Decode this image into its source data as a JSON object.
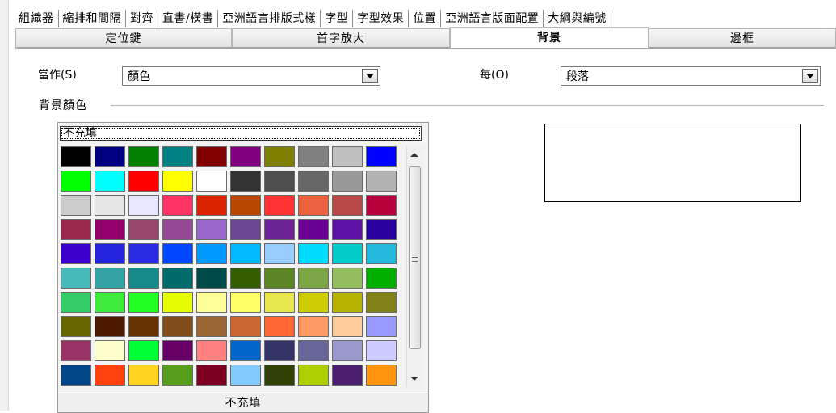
{
  "tabs_row1": [
    "組織器",
    "縮排和間隔",
    "對齊",
    "直書/橫書",
    "亞洲語言排版式樣",
    "字型",
    "字型效果",
    "位置",
    "亞洲語言版面配置",
    "大綱與編號"
  ],
  "tabs_row2": [
    {
      "label": "定位鍵",
      "active": false
    },
    {
      "label": "首字放大",
      "active": false
    },
    {
      "label": "背景",
      "active": true
    },
    {
      "label": "邊框",
      "active": false
    }
  ],
  "as_field": {
    "label": "當作(S)",
    "value": "顏色"
  },
  "for_field": {
    "label": "每(O)",
    "value": "段落"
  },
  "group_title": "背景顏色",
  "no_fill_top": "不充填",
  "no_fill_bottom": "不充填",
  "palette": [
    [
      "#000000",
      "#000080",
      "#008000",
      "#008080",
      "#800000",
      "#800080",
      "#808000",
      "#808080",
      "#c0c0c0",
      "#0000ff"
    ],
    [
      "#00ff00",
      "#00ffff",
      "#ff0000",
      "#ffff00",
      "#ffffff",
      "#333333",
      "#4d4d4d",
      "#666666",
      "#999999",
      "#b3b3b3"
    ],
    [
      "#cccccc",
      "#e6e6e6",
      "#e6e6ff",
      "#ff3366",
      "#dc2300",
      "#b84700",
      "#ff3333",
      "#eb613d",
      "#b84747",
      "#b8003d"
    ],
    [
      "#99284c",
      "#94006b",
      "#94476b",
      "#944794",
      "#9966cc",
      "#6b4794",
      "#6b2394",
      "#6b0094",
      "#5e11a6",
      "#28009e"
    ],
    [
      "#3d00cc",
      "#2323dc",
      "#2a2ae0",
      "#0047ff",
      "#0099ff",
      "#00b8ff",
      "#99ccff",
      "#00dcff",
      "#00cccc",
      "#23b8dc"
    ],
    [
      "#47b8b8",
      "#33a3a3",
      "#198a8a",
      "#006b6b",
      "#004a4a",
      "#355e00",
      "#5c8526",
      "#7da647",
      "#94bd5e",
      "#00ae00"
    ],
    [
      "#33cc66",
      "#3deb3d",
      "#23ff23",
      "#e6ff00",
      "#ffff99",
      "#ffff66",
      "#e6e64c",
      "#cccc00",
      "#b3b300",
      "#808019"
    ],
    [
      "#666600",
      "#4c1900",
      "#663300",
      "#804c19",
      "#996633",
      "#cc6633",
      "#ff6633",
      "#ff9966",
      "#ffcc99",
      "#9999ff"
    ],
    [
      "#993366",
      "#ffffcc",
      "#00ff33",
      "#660066",
      "#ff8080",
      "#0066cc",
      "#333366",
      "#666699",
      "#9999cc",
      "#ccccff"
    ],
    [
      "#004586",
      "#ff420e",
      "#ffd320",
      "#579d1c",
      "#7e0021",
      "#83caff",
      "#314004",
      "#aecf00",
      "#4b1f6f",
      "#ff950e"
    ]
  ]
}
